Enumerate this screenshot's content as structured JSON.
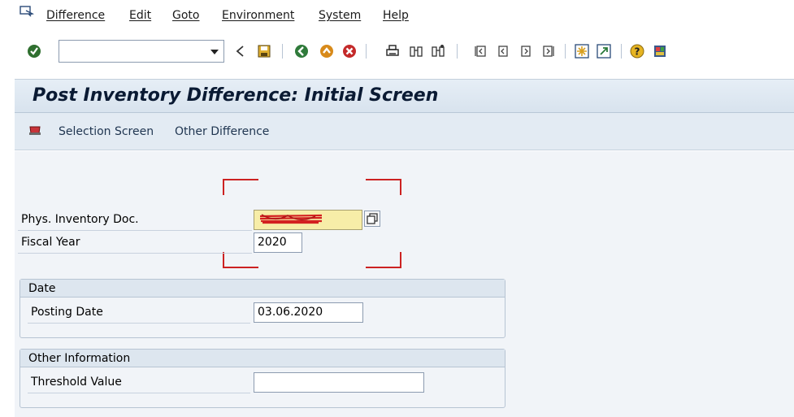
{
  "menu": {
    "items": [
      "Difference",
      "Edit",
      "Goto",
      "Environment",
      "System",
      "Help"
    ]
  },
  "toolbar": {
    "command_value": "",
    "icons": [
      "enter-icon",
      "back-icon",
      "save-icon",
      "back-nav-icon",
      "exit-icon",
      "cancel-icon",
      "print-icon",
      "find-icon",
      "find-next-icon",
      "first-page-icon",
      "prev-page-icon",
      "next-page-icon",
      "last-page-icon",
      "new-session-icon",
      "shortcut-icon",
      "help-icon",
      "layout-icon"
    ]
  },
  "title": "Post Inventory Difference: Initial Screen",
  "app_toolbar": {
    "selection_screen": "Selection Screen",
    "other_difference": "Other Difference"
  },
  "form": {
    "phys_inventory_doc_label": "Phys. Inventory Doc.",
    "phys_inventory_doc_value": "",
    "fiscal_year_label": "Fiscal Year",
    "fiscal_year_value": "2020"
  },
  "date_group": {
    "title": "Date",
    "posting_date_label": "Posting Date",
    "posting_date_value": "03.06.2020"
  },
  "other_group": {
    "title": "Other Information",
    "threshold_label": "Threshold Value",
    "threshold_value": ""
  },
  "colors": {
    "title_text": "#0a1a33",
    "required_field": "#f7eda8",
    "focus_corners": "#cc2222"
  }
}
